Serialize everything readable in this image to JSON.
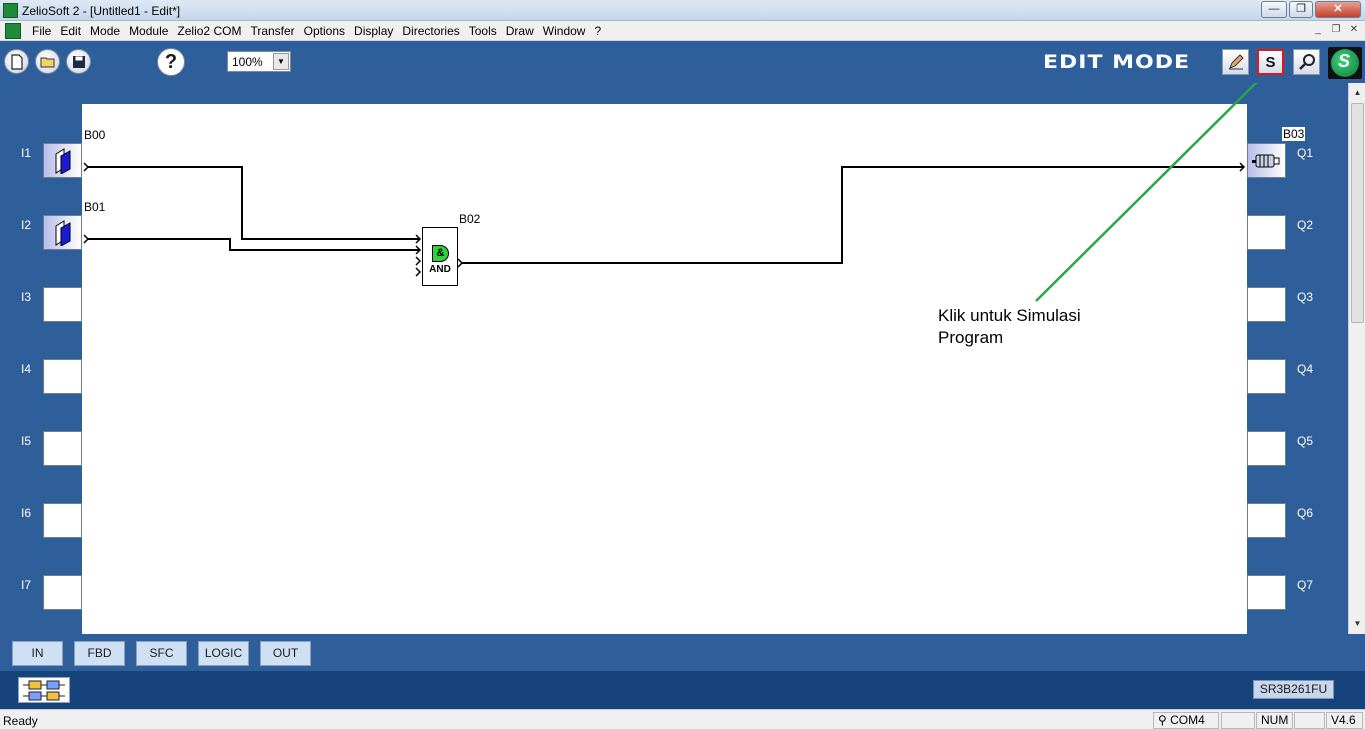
{
  "window": {
    "title": "ZelioSoft 2 - [Untitled1 - Edit*]",
    "minimize_glyph": "—",
    "maximize_glyph": "❐",
    "close_glyph": "✕"
  },
  "menu": {
    "items": [
      "File",
      "Edit",
      "Mode",
      "Module",
      "Zelio2 COM",
      "Transfer",
      "Options",
      "Display",
      "Directories",
      "Tools",
      "Draw",
      "Window",
      "?"
    ],
    "mdi_minimize": "_",
    "mdi_restore": "❐",
    "mdi_close": "✕"
  },
  "toolbar": {
    "new_icon": "new-document-icon",
    "open_icon": "open-folder-icon",
    "save_icon": "save-disk-icon",
    "help_label": "?",
    "zoom_value": "100%",
    "mode_label": "EDIT MODE",
    "simulation_label": "S"
  },
  "inputs": [
    {
      "label": "I1",
      "block": "B00"
    },
    {
      "label": "I2",
      "block": "B01"
    },
    {
      "label": "I3"
    },
    {
      "label": "I4"
    },
    {
      "label": "I5"
    },
    {
      "label": "I6"
    },
    {
      "label": "I7"
    }
  ],
  "outputs": [
    {
      "label": "Q1",
      "block": "B03"
    },
    {
      "label": "Q2"
    },
    {
      "label": "Q3"
    },
    {
      "label": "Q4"
    },
    {
      "label": "Q5"
    },
    {
      "label": "Q6"
    },
    {
      "label": "Q7"
    }
  ],
  "function_block": {
    "id": "B02",
    "symbol": "&",
    "type": "AND",
    "color": "#2fd23a"
  },
  "annotation": {
    "line1": "Klik untuk Simulasi",
    "line2": "Program",
    "color": "#2aa64a"
  },
  "tabs": [
    "IN",
    "FBD",
    "SFC",
    "LOGIC",
    "OUT"
  ],
  "module_ref": "SR3B261FU",
  "status": {
    "text": "Ready",
    "com": "COM4",
    "num": "NUM",
    "version": "V4.6"
  }
}
